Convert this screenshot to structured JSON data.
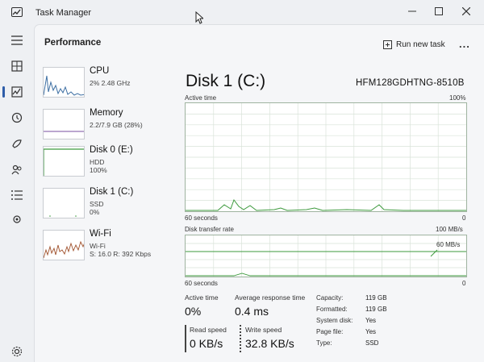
{
  "window": {
    "title": "Task Manager"
  },
  "header": {
    "title": "Performance",
    "run_new_task": "Run new task",
    "more": "..."
  },
  "rail": {
    "icons": [
      "menu-icon",
      "processes-icon",
      "performance-icon",
      "app-history-icon",
      "startup-apps-icon",
      "users-icon",
      "details-icon",
      "services-icon",
      "settings-icon"
    ]
  },
  "resources": [
    {
      "name": "CPU",
      "lines": [
        "2% 2.48 GHz"
      ]
    },
    {
      "name": "Memory",
      "lines": [
        "2.2/7.9 GB (28%)"
      ]
    },
    {
      "name": "Disk 0 (E:)",
      "lines": [
        "HDD",
        "100%"
      ]
    },
    {
      "name": "Disk 1 (C:)",
      "lines": [
        "SSD",
        "0%"
      ]
    },
    {
      "name": "Wi-Fi",
      "lines": [
        "Wi-Fi",
        "S: 16.0  R: 392 Kbps"
      ]
    }
  ],
  "detail": {
    "title": "Disk 1 (C:)",
    "model": "HFM128GDHTNG-8510B",
    "active_time": {
      "label": "Active time",
      "max": "100%",
      "span": "60 seconds",
      "min": "0"
    },
    "transfer_rate": {
      "label": "Disk transfer rate",
      "max": "100 MB/s",
      "marker": "60 MB/s",
      "span": "60 seconds",
      "min": "0"
    }
  },
  "stats": {
    "active_time_label": "Active time",
    "active_time_value": "0%",
    "avg_response_label": "Average response time",
    "avg_response_value": "0.4 ms",
    "read_label": "Read speed",
    "read_value": "0 KB/s",
    "write_label": "Write speed",
    "write_value": "32.8 KB/s"
  },
  "properties": [
    {
      "label": "Capacity:",
      "value": "119 GB"
    },
    {
      "label": "Formatted:",
      "value": "119 GB"
    },
    {
      "label": "System disk:",
      "value": "Yes"
    },
    {
      "label": "Page file:",
      "value": "Yes"
    },
    {
      "label": "Type:",
      "value": "SSD"
    }
  ],
  "colors": {
    "accent": "#2e5da8",
    "cpu": "#3d6fa3",
    "memory": "#7a4fa0",
    "disk": "#3d9a3d",
    "wifi": "#a0522d",
    "grid": "#d9e3d9"
  }
}
